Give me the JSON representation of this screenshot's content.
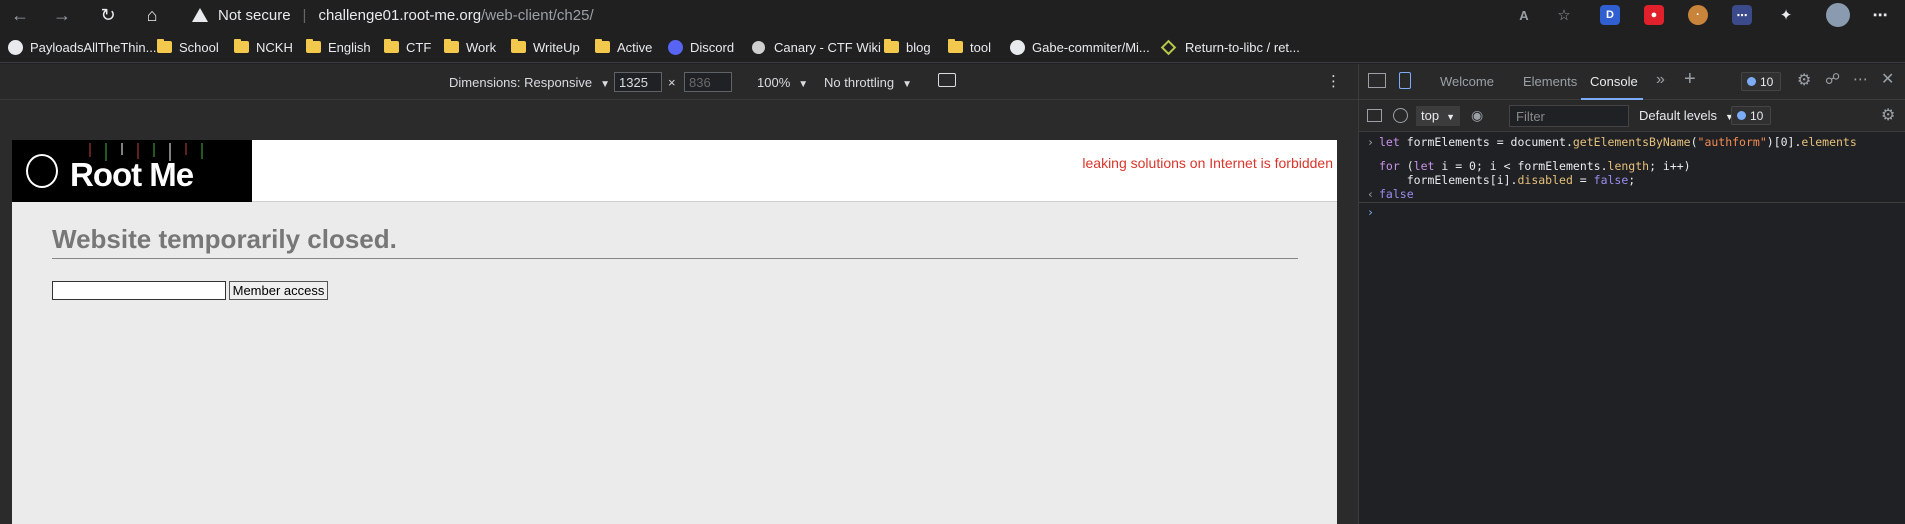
{
  "address_bar": {
    "security_label": "Not secure",
    "url_host": "challenge01.root-me.org",
    "url_path": "/web-client/ch25/"
  },
  "bookmarks": [
    {
      "label": "PayloadsAllTheThin...",
      "icon": "github-icon"
    },
    {
      "label": "School",
      "icon": "folder-icon"
    },
    {
      "label": "NCKH",
      "icon": "folder-icon"
    },
    {
      "label": "English",
      "icon": "folder-icon"
    },
    {
      "label": "CTF",
      "icon": "folder-icon"
    },
    {
      "label": "Work",
      "icon": "folder-icon"
    },
    {
      "label": "WriteUp",
      "icon": "folder-icon"
    },
    {
      "label": "Active",
      "icon": "folder-icon"
    },
    {
      "label": "Discord",
      "icon": "discord-icon"
    },
    {
      "label": "Canary - CTF Wiki",
      "icon": "canary-icon"
    },
    {
      "label": "blog",
      "icon": "folder-icon"
    },
    {
      "label": "tool",
      "icon": "folder-icon"
    },
    {
      "label": "Gabe-commiter/Mi...",
      "icon": "github-icon"
    },
    {
      "label": "Return-to-libc / ret...",
      "icon": "diamond-icon"
    }
  ],
  "device_toolbar": {
    "dimensions_label": "Dimensions: Responsive",
    "width": "1325",
    "height_placeholder": "836",
    "times": "×",
    "zoom": "100%",
    "throttling": "No throttling"
  },
  "page": {
    "logo_text": "Root Me",
    "forbidden_notice": "leaking solutions on Internet is forbidden",
    "heading": "Website temporarily closed.",
    "input_value": "",
    "button_label": "Member access"
  },
  "devtools": {
    "tabs": [
      "Welcome",
      "Elements",
      "Console"
    ],
    "active_tab": "Console",
    "issues_count": "10",
    "context": "top",
    "filter_placeholder": "Filter",
    "levels": "Default levels",
    "levels_count": "10",
    "console_lines": {
      "l1_kw": "let",
      "l1_a": " formElements = document.",
      "l1_prop": "getElementsByName",
      "l1_b": "(",
      "l1_str": "\"authform\"",
      "l1_c": ")[0].",
      "l1_prop2": "elements",
      "l2_kw": "for",
      "l2_a": " (",
      "l2_kw2": "let",
      "l2_b": " i = 0; i < formElements.",
      "l2_prop": "length",
      "l2_c": "; i++)",
      "l3_a": "    formElements[i].",
      "l3_prop": "disabled",
      "l3_b": " = ",
      "l3_bool": "false",
      "l3_c": ";",
      "result": "false"
    }
  },
  "colors": {
    "notice_red": "#d9352b",
    "heading_gray": "#777777",
    "accent_blue": "#7cacf8"
  }
}
